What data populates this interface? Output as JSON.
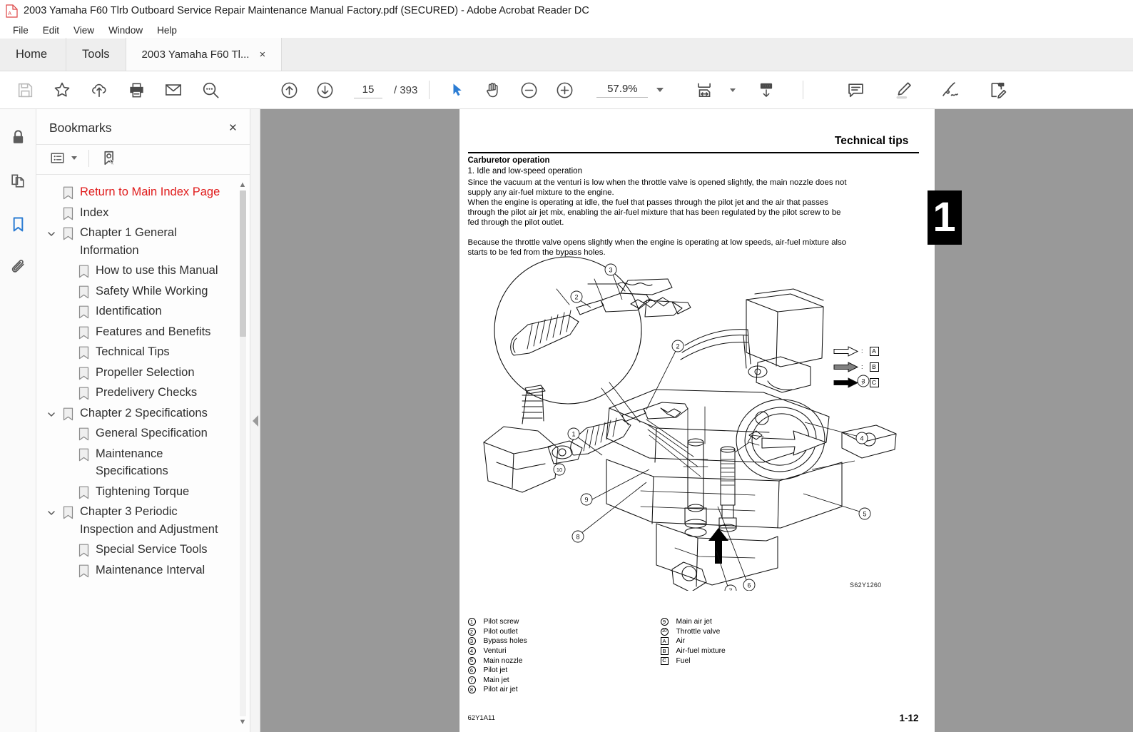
{
  "window": {
    "title": "2003 Yamaha F60 Tlrb Outboard Service Repair Maintenance Manual Factory.pdf (SECURED) - Adobe Acrobat Reader DC",
    "app_icon": "pdf-file-icon"
  },
  "menubar": {
    "items": [
      {
        "label": "File"
      },
      {
        "label": "Edit"
      },
      {
        "label": "View"
      },
      {
        "label": "Window"
      },
      {
        "label": "Help"
      }
    ]
  },
  "tabs": {
    "home_label": "Home",
    "tools_label": "Tools",
    "document_label": "2003 Yamaha F60 Tl...",
    "close_glyph": "×"
  },
  "toolbar": {
    "left_icons": [
      {
        "name": "save-icon",
        "label": "Save"
      },
      {
        "name": "star-icon",
        "label": "Add to favorites"
      },
      {
        "name": "cloud-upload-icon",
        "label": "Upload"
      },
      {
        "name": "print-icon",
        "label": "Print"
      },
      {
        "name": "email-icon",
        "label": "Send by email"
      },
      {
        "name": "search-icon",
        "label": "Find"
      }
    ],
    "page_up_label": "Previous page",
    "page_down_label": "Next page",
    "current_page": "15",
    "page_total": "/ 393",
    "select_tool_label": "Select tool",
    "hand_tool_label": "Hand tool",
    "zoom_out_label": "Zoom out",
    "zoom_in_label": "Zoom in",
    "zoom_value": "57.9%",
    "fit_page_label": "Fit page width",
    "scroll_mode_label": "Scrolling mode",
    "right_icons": [
      {
        "name": "comment-icon",
        "label": "Add comment"
      },
      {
        "name": "highlight-icon",
        "label": "Highlight text"
      },
      {
        "name": "sign-icon",
        "label": "Sign"
      },
      {
        "name": "fill-and-sign-icon",
        "label": "Fill & Sign"
      }
    ],
    "accent_color": "#2b7cd3"
  },
  "rail": {
    "items": [
      {
        "name": "security-lock-icon",
        "label": "Security settings",
        "active": false
      },
      {
        "name": "page-thumbnails-icon",
        "label": "Page thumbnails",
        "active": false
      },
      {
        "name": "bookmarks-icon",
        "label": "Bookmarks",
        "active": true
      },
      {
        "name": "attachments-icon",
        "label": "Attachments",
        "active": false
      }
    ]
  },
  "bookmarks_panel": {
    "title": "Bookmarks",
    "close_glyph": "×",
    "options_label": "Bookmark options",
    "new_bookmark_label": "New bookmark",
    "items": [
      {
        "label": "Return to Main Index Page",
        "level": 0,
        "expandable": false,
        "red": true
      },
      {
        "label": "Index",
        "level": 0,
        "expandable": false,
        "red": false
      },
      {
        "label": "Chapter 1 General Information",
        "level": 0,
        "expandable": true,
        "red": false
      },
      {
        "label": "How to use this Manual",
        "level": 1,
        "expandable": false,
        "red": false
      },
      {
        "label": "Safety While Working",
        "level": 1,
        "expandable": false,
        "red": false
      },
      {
        "label": "Identification",
        "level": 1,
        "expandable": false,
        "red": false
      },
      {
        "label": "Features and Benefits",
        "level": 1,
        "expandable": false,
        "red": false
      },
      {
        "label": "Technical Tips",
        "level": 1,
        "expandable": false,
        "red": false
      },
      {
        "label": "Propeller Selection",
        "level": 1,
        "expandable": false,
        "red": false
      },
      {
        "label": "Predelivery Checks",
        "level": 1,
        "expandable": false,
        "red": false
      },
      {
        "label": "Chapter 2 Specifications",
        "level": 0,
        "expandable": true,
        "red": false
      },
      {
        "label": "General Specification",
        "level": 1,
        "expandable": false,
        "red": false
      },
      {
        "label": "Maintenance Specifications",
        "level": 1,
        "expandable": false,
        "red": false
      },
      {
        "label": "Tightening Torque",
        "level": 1,
        "expandable": false,
        "red": false
      },
      {
        "label": "Chapter 3 Periodic Inspection and Adjustment",
        "level": 0,
        "expandable": true,
        "red": false
      },
      {
        "label": "Special Service Tools",
        "level": 1,
        "expandable": false,
        "red": false
      },
      {
        "label": "Maintenance Interval",
        "level": 1,
        "expandable": false,
        "red": false
      }
    ]
  },
  "document": {
    "header_title": "Technical tips",
    "section_heading": "Carburetor operation",
    "subsection": "1. Idle and low-speed operation",
    "paragraph_1": "Since the vacuum at the venturi is low when the throttle valve is opened slightly, the main nozzle does not supply any air-fuel mixture to the engine.",
    "paragraph_2": "When the engine is operating at idle, the fuel that passes through the pilot jet and the air that passes through the pilot air jet mix, enabling the air-fuel mixture that has been regulated by the pilot screw to be fed through the pilot outlet.",
    "paragraph_3": "Because the throttle valve opens slightly when the engine is operating at low speeds, air-fuel mixture also starts to be fed from the bypass holes.",
    "chapter_tab": "1",
    "figure_id": "S62Y1260",
    "footer_left": "62Y1A11",
    "footer_right": "1-12",
    "legend_left": [
      {
        "mark": "1",
        "shape": "circle",
        "label": "Pilot screw"
      },
      {
        "mark": "2",
        "shape": "circle",
        "label": "Pilot outlet"
      },
      {
        "mark": "3",
        "shape": "circle",
        "label": "Bypass holes"
      },
      {
        "mark": "4",
        "shape": "circle",
        "label": "Venturi"
      },
      {
        "mark": "5",
        "shape": "circle",
        "label": "Main nozzle"
      },
      {
        "mark": "6",
        "shape": "circle",
        "label": "Pilot jet"
      },
      {
        "mark": "7",
        "shape": "circle",
        "label": "Main jet"
      },
      {
        "mark": "8",
        "shape": "circle",
        "label": "Pilot air jet"
      }
    ],
    "legend_right": [
      {
        "mark": "9",
        "shape": "circle",
        "label": "Main air jet"
      },
      {
        "mark": "10",
        "shape": "circle",
        "label": "Throttle valve"
      },
      {
        "mark": "A",
        "shape": "square",
        "label": "Air"
      },
      {
        "mark": "B",
        "shape": "square",
        "label": "Air-fuel mixture"
      },
      {
        "mark": "C",
        "shape": "square",
        "label": "Fuel"
      }
    ],
    "arrow_key": [
      {
        "mark": "A",
        "fill": "#ffffff",
        "label": "Air"
      },
      {
        "mark": "B",
        "fill": "#808080",
        "label": "Air-fuel mixture"
      },
      {
        "mark": "C",
        "fill": "#000000",
        "label": "Fuel"
      }
    ],
    "figure_callouts": [
      "1",
      "2",
      "3",
      "4",
      "5",
      "6",
      "7",
      "8",
      "9",
      "10"
    ]
  },
  "colors": {
    "viewer_background": "#999999",
    "page_background": "#ffffff",
    "panel_background": "#fdfdfd",
    "bookmark_red": "#e01b1b",
    "accent_blue": "#2b7cd3"
  }
}
